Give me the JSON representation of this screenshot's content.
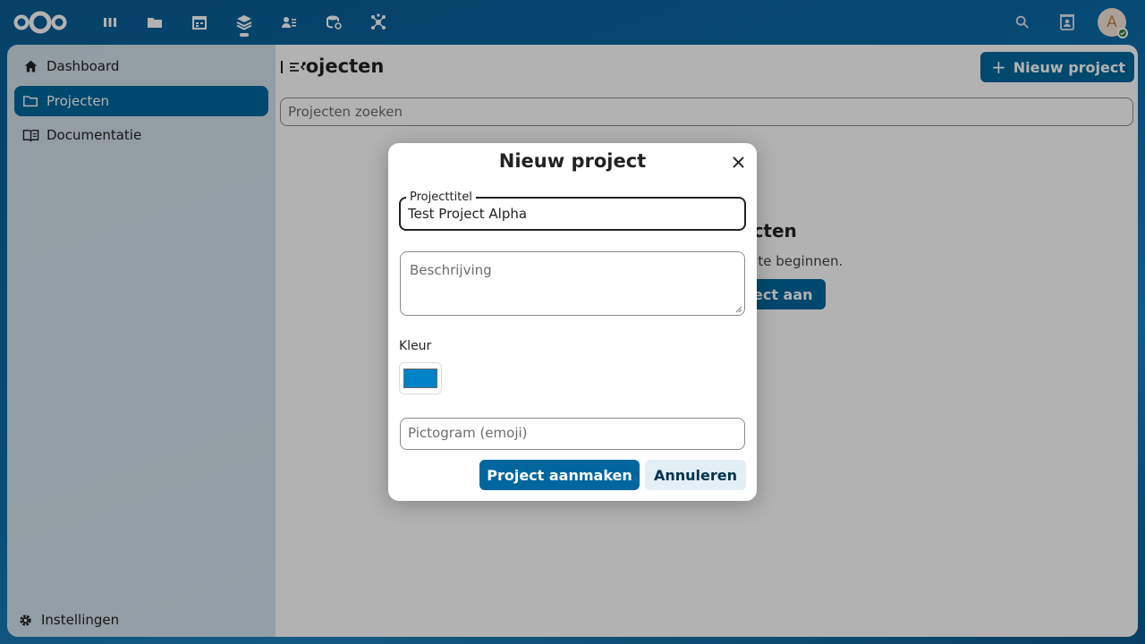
{
  "header": {
    "apps": [
      {
        "icon": "dashboard-icon"
      },
      {
        "icon": "files-icon"
      },
      {
        "icon": "calendar-icon"
      },
      {
        "icon": "projects-icon",
        "active": true
      },
      {
        "icon": "contacts-icon"
      },
      {
        "icon": "storage-icon"
      },
      {
        "icon": "network-icon"
      }
    ],
    "avatar_initial": "A"
  },
  "sidebar": {
    "items": [
      {
        "label": "Dashboard",
        "icon": "home-icon"
      },
      {
        "label": "Projecten",
        "icon": "folder-icon",
        "active": true
      },
      {
        "label": "Documentatie",
        "icon": "book-icon"
      }
    ],
    "settings_label": "Instellingen"
  },
  "main": {
    "title": "Projecten",
    "new_project_label": "Nieuw project",
    "search_placeholder": "Projecten zoeken",
    "empty_title": "ecten",
    "empty_desc": "m te beginnen.",
    "empty_button": "ect aan"
  },
  "dialog": {
    "title": "Nieuw project",
    "title_field_label": "Projecttitel",
    "title_field_value": "Test Project Alpha",
    "description_placeholder": "Beschrijving",
    "color_label": "Kleur",
    "color_value": "#0082c9",
    "icon_placeholder": "Pictogram (emoji)",
    "create_label": "Project aanmaken",
    "cancel_label": "Annuleren"
  },
  "colors": {
    "primary": "#00679e",
    "accent": "#0082c9"
  }
}
